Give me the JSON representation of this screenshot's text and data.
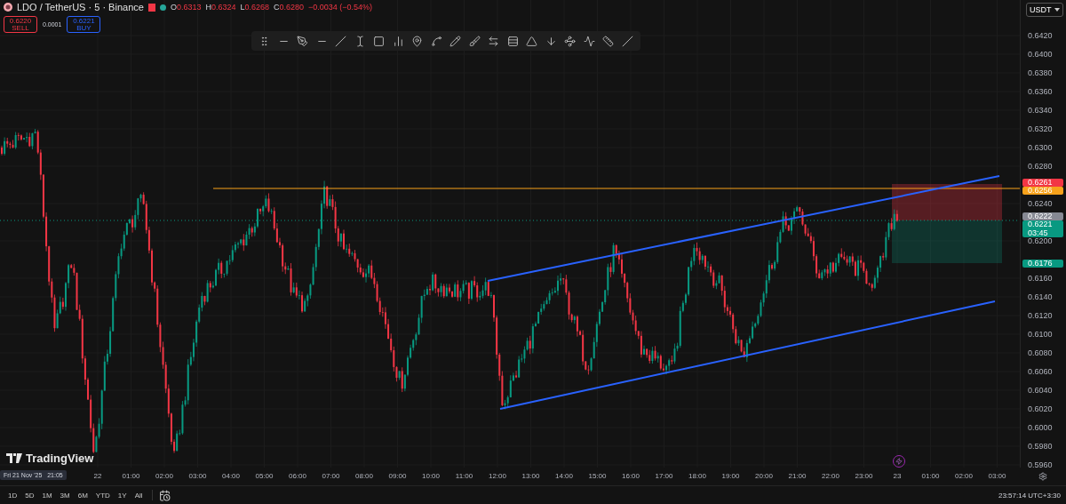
{
  "symbol_bar": {
    "title": "LDO / TetherUS · 5 · Binance",
    "ohlc": [
      {
        "label": "O",
        "value": "0.6313"
      },
      {
        "label": "H",
        "value": "0.6324"
      },
      {
        "label": "L",
        "value": "0.6268"
      },
      {
        "label": "C",
        "value": "0.6280"
      }
    ],
    "change": "−0.0034 (−0.54%)"
  },
  "trade_buttons": [
    {
      "kind": "sell",
      "price": "0.6220",
      "label": "SELL"
    },
    {
      "kind": "buy",
      "price": "0.6221",
      "label": "BUY"
    }
  ],
  "spread": "0.0001",
  "currency": "USDT",
  "price_axis": {
    "ticks": [
      "0.6420",
      "0.6400",
      "0.6380",
      "0.6360",
      "0.6340",
      "0.6320",
      "0.6300",
      "0.6280",
      "0.6240",
      "0.6200",
      "0.6160",
      "0.6140",
      "0.6120",
      "0.6100",
      "0.6080",
      "0.6060",
      "0.6040",
      "0.6020",
      "0.6000",
      "0.5980",
      "0.5960"
    ],
    "badges": [
      {
        "value": "0.6261",
        "color": "#f23645"
      },
      {
        "value": "0.6256",
        "color": "#f7a21b"
      },
      {
        "value": "0.6222",
        "color": "#868993"
      },
      {
        "value": "0.6221",
        "sub": "03:45",
        "color": "#089981"
      },
      {
        "value": "0.6176",
        "color": "#089981"
      }
    ]
  },
  "logo": "TradingView",
  "time_axis": {
    "cursor_label": "Fri 21 Nov '25   21:05",
    "labels": [
      "22",
      "01:00",
      "02:00",
      "03:00",
      "04:00",
      "05:00",
      "06:00",
      "07:00",
      "08:00",
      "09:00",
      "10:00",
      "11:00",
      "12:00",
      "13:00",
      "14:00",
      "15:00",
      "16:00",
      "17:00",
      "18:00",
      "19:00",
      "20:00",
      "21:00",
      "22:00",
      "23:00",
      "23",
      "01:00",
      "02:00",
      "03:00"
    ]
  },
  "ranges": [
    "1D",
    "5D",
    "1M",
    "3M",
    "6M",
    "YTD",
    "1Y",
    "All"
  ],
  "clock": "23:57:14 UTC+3:30"
}
